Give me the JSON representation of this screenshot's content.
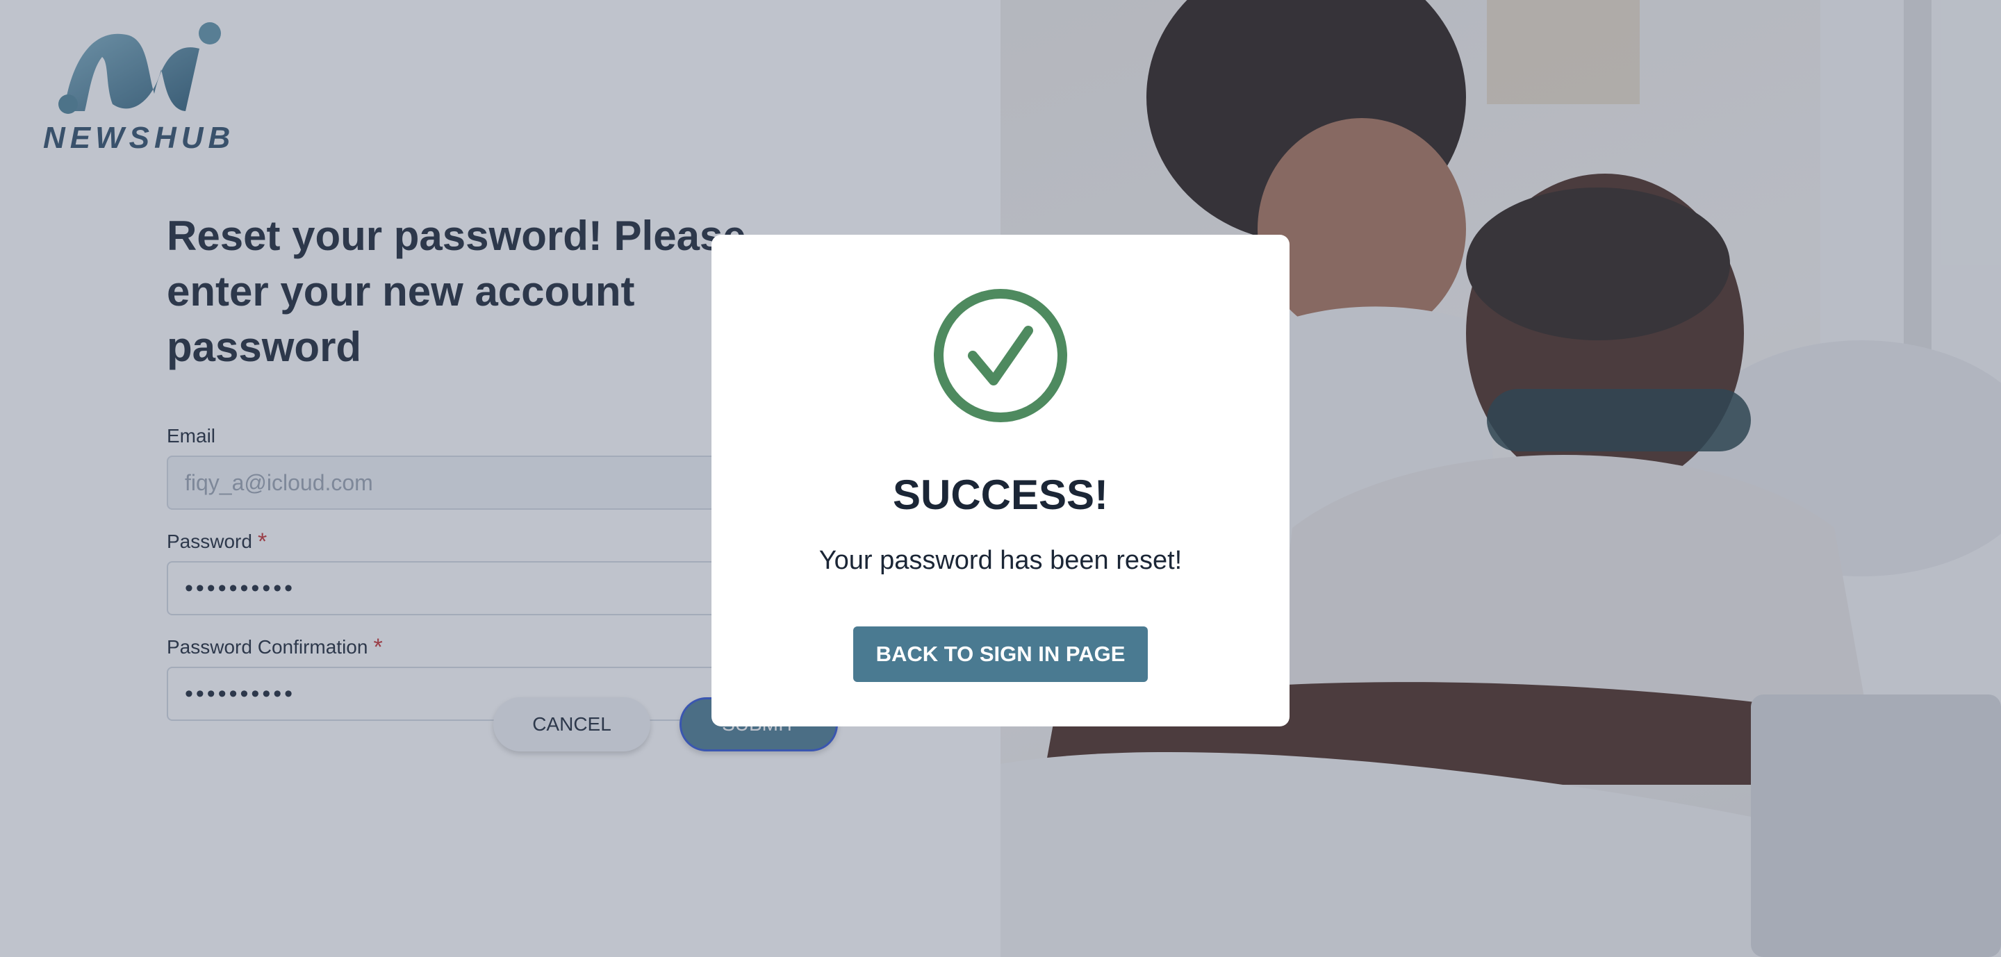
{
  "brand": {
    "name": "NEWSHUB"
  },
  "form": {
    "heading": "Reset your password! Please enter your new account password",
    "email": {
      "label": "Email",
      "value": "fiqy_a@icloud.com"
    },
    "password": {
      "label": "Password",
      "required_mark": "*",
      "value": "••••••••••"
    },
    "password_confirmation": {
      "label": "Password Confirmation",
      "required_mark": "*",
      "value": "••••••••••"
    },
    "cancel_label": "CANCEL",
    "submit_label": "SUBMIT"
  },
  "modal": {
    "icon": "check-circle-icon",
    "title": "SUCCESS!",
    "message": "Your password has been reset!",
    "button_label": "BACK TO SIGN IN PAGE"
  },
  "colors": {
    "accent": "#4a7a91",
    "success": "#4e8a5f",
    "text": "#1b2636",
    "required": "#c53030",
    "overlay": "rgba(78, 90, 114, 0.36)"
  }
}
